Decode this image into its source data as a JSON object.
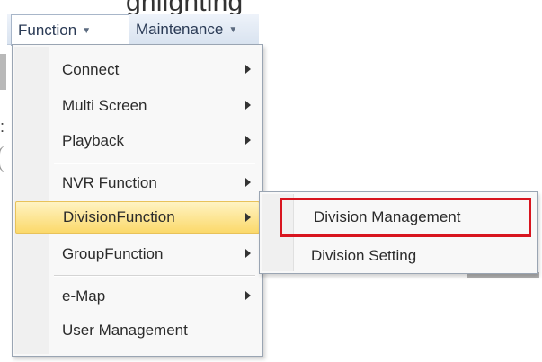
{
  "top_fragment": "ghlighting",
  "menubar": {
    "items": [
      {
        "label": "Function",
        "active": true
      },
      {
        "label": "Maintenance",
        "active": false
      }
    ]
  },
  "function_menu": {
    "items": [
      {
        "label": "Connect",
        "has_submenu": true
      },
      {
        "label": "Multi Screen",
        "has_submenu": true
      },
      {
        "label": "Playback",
        "has_submenu": true
      },
      {
        "label": "NVR Function",
        "has_submenu": true
      },
      {
        "label": "DivisionFunction",
        "has_submenu": true,
        "highlighted": true
      },
      {
        "label": "GroupFunction",
        "has_submenu": true
      },
      {
        "label": "e-Map",
        "has_submenu": true
      },
      {
        "label": "User Management",
        "has_submenu": false
      }
    ]
  },
  "division_submenu": {
    "items": [
      {
        "label": "Division Management",
        "outlined_in_red": true
      },
      {
        "label": "Division Setting",
        "outlined_in_red": false
      }
    ],
    "highlight_color": "#d8151f"
  },
  "edge_glyph": ":"
}
